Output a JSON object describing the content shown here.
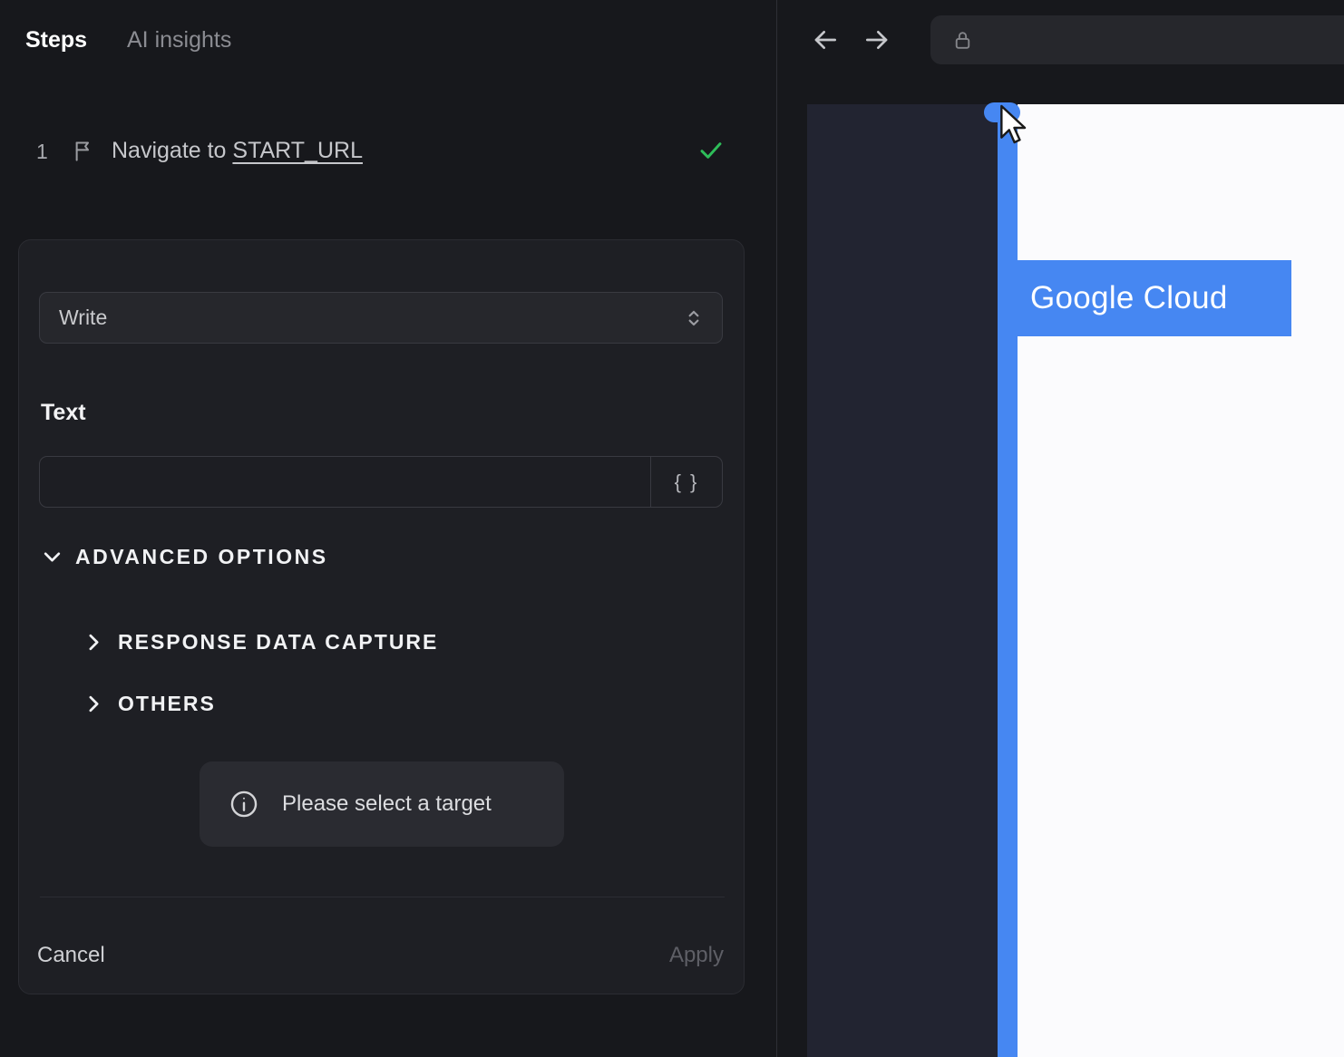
{
  "left_panel": {
    "tabs": {
      "steps": "Steps",
      "ai_insights": "AI insights"
    },
    "step": {
      "number": "1",
      "title_prefix": "Navigate to ",
      "title_link": "START_URL"
    },
    "editor": {
      "action_select_value": "Write",
      "text_label": "Text",
      "text_input_value": "",
      "braces_button_label": "{ }",
      "advanced_options_label": "ADVANCED OPTIONS",
      "response_data_capture_label": "RESPONSE DATA CAPTURE",
      "others_label": "OTHERS",
      "toast_message": "Please select a target",
      "cancel_label": "Cancel",
      "apply_label": "Apply"
    }
  },
  "browser": {
    "url_value": "",
    "page": {
      "brand_text": "Google Cloud"
    }
  },
  "colors": {
    "accent_blue": "#4687f2",
    "success_green": "#2ebd59"
  }
}
